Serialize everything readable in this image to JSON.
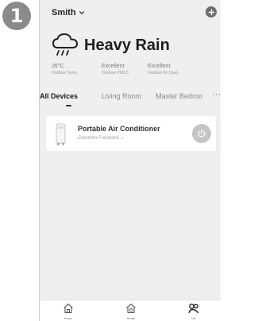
{
  "step": {
    "number": "1"
  },
  "header": {
    "home_name": "Smith",
    "chevron_icon": "chevron-down-icon",
    "add_icon": "plus-circle-icon"
  },
  "weather": {
    "icon": "cloud-rain-icon",
    "condition": "Heavy Rain",
    "stats": [
      {
        "value": "26°C",
        "label": "Outdoor Temp."
      },
      {
        "value": "Excellent",
        "label": "Outdoor PM2.5"
      },
      {
        "value": "Excellent",
        "label": "Outdoor Air Qual..."
      }
    ]
  },
  "rooms": {
    "tabs": [
      {
        "label": "All Devices",
        "active": true
      },
      {
        "label": "Living Room",
        "active": false
      },
      {
        "label": "Master Bedroo",
        "active": false
      }
    ],
    "more_label": "···"
  },
  "devices": [
    {
      "name": "Portable Air Conditioner",
      "subtitle": "Common Functions ⌄",
      "icon": "air-conditioner-icon",
      "power_icon": "power-icon"
    }
  ],
  "bottom_nav": {
    "items": [
      {
        "label": "Home",
        "icon": "home-icon"
      },
      {
        "label": "Smart",
        "icon": "smart-house-icon"
      },
      {
        "label": "Me",
        "icon": "me-icon"
      }
    ]
  },
  "colors": {
    "background": "#efefef",
    "card": "#ffffff",
    "power_button": "#c5c5c5",
    "badge": "#8a8a8a"
  }
}
